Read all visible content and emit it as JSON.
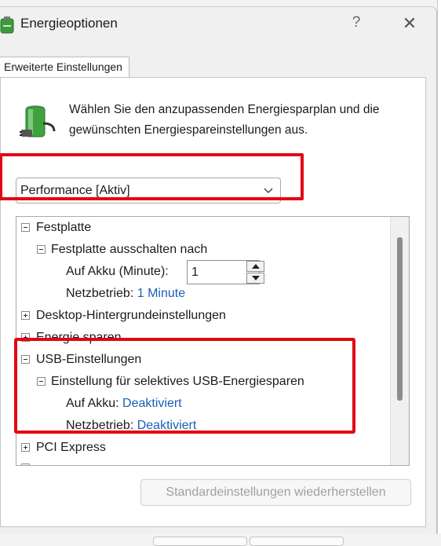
{
  "window": {
    "title": "Energieoptionen",
    "help_glyph": "?",
    "close_glyph": "✕"
  },
  "tabs": [
    {
      "label": "Erweiterte Einstellungen"
    }
  ],
  "intro": {
    "text": "Wählen Sie den anzupassenden Energiesparplan und die gewünschten Energiespareinstellungen aus."
  },
  "plan_select": {
    "value": "Performance [Aktiv]"
  },
  "tree": {
    "festplatte": "Festplatte",
    "festplatte_off": "Festplatte ausschalten nach",
    "akku_minute_label": "Auf Akku (Minute):",
    "akku_minute_value": "1",
    "netz_label": "Netzbetrieb:",
    "netz_value": "1 Minute",
    "desktop_bg": "Desktop-Hintergrundeinstellungen",
    "energie_sparen": "Energie sparen",
    "usb": "USB-Einstellungen",
    "usb_selective": "Einstellung für selektives USB-Energiesparen",
    "usb_akku_label": "Auf Akku:",
    "usb_akku_value": "Deaktiviert",
    "usb_netz_label": "Netzbetrieb:",
    "usb_netz_value": "Deaktiviert",
    "pci": "PCI Express"
  },
  "buttons": {
    "restore": "Standardeinstellungen wiederherstellen"
  },
  "colors": {
    "highlight": "#e30613",
    "link": "#1a5fb4"
  }
}
